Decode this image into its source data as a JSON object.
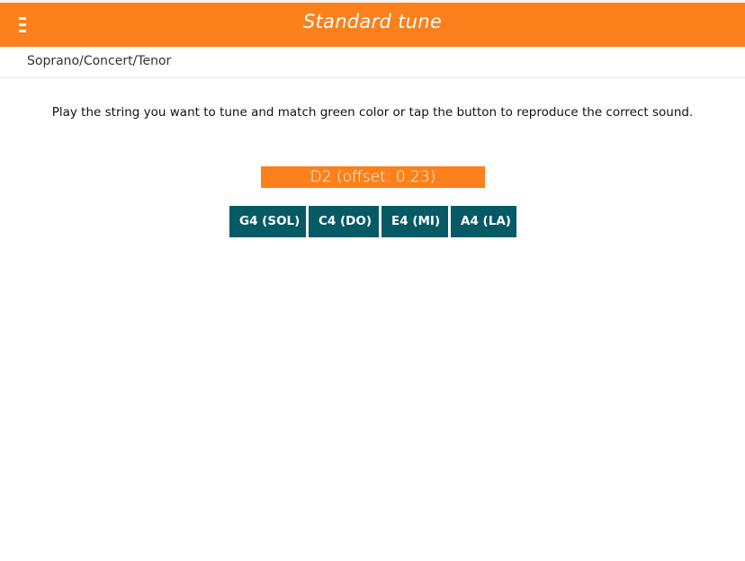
{
  "header": {
    "title": "Standard tune",
    "menu_icon": "hamburger-menu-icon",
    "background_color": "#fc801c"
  },
  "breadcrumb": {
    "text": "Soprano/Concert/Tenor"
  },
  "main": {
    "instructions": "Play the string you want to tune and match green color or tap the button to reproduce the correct sound.",
    "detected_note": "D2 (offset: 0.23)",
    "detected_note_color": "#fc801c",
    "string_buttons": [
      {
        "label": "G4 (SOL)"
      },
      {
        "label": "C4 (DO)"
      },
      {
        "label": "E4 (MI)"
      },
      {
        "label": "A4 (LA)"
      }
    ],
    "button_color": "#055a66"
  }
}
